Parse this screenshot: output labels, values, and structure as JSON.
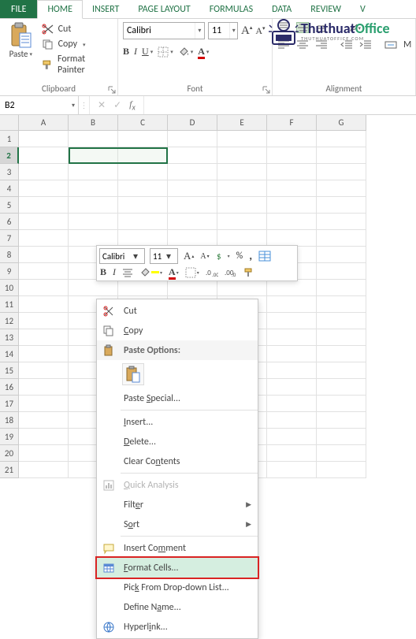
{
  "ribbon": {
    "tabs": {
      "file": "FILE",
      "home": "HOME",
      "insert": "INSERT",
      "pagelayout": "PAGE LAYOUT",
      "formulas": "FORMULAS",
      "data": "DATA",
      "review": "REVIEW",
      "v": "V"
    },
    "clipboard": {
      "paste": "Paste",
      "cut": "Cut",
      "copy": "Copy",
      "formatpainter": "Format Painter",
      "label": "Clipboard"
    },
    "font": {
      "name": "Calibri",
      "size": "11",
      "label": "Font"
    },
    "alignment": {
      "label": "Alignment",
      "merge_m": "M"
    }
  },
  "logo": {
    "thuthuat": "Thuthuat",
    "office": "Office",
    "sub": "THUTHUATOFFICE.COM"
  },
  "fxbar": {
    "namebox": "B2"
  },
  "grid": {
    "cols": [
      "A",
      "B",
      "C",
      "D",
      "E",
      "F",
      "G"
    ],
    "rows": [
      "1",
      "2",
      "3",
      "4",
      "5",
      "6",
      "7",
      "8",
      "9",
      "10",
      "11",
      "12",
      "13",
      "14",
      "15",
      "16",
      "17",
      "18",
      "19",
      "20",
      "21"
    ],
    "sel_row": "2"
  },
  "minibar": {
    "fname": "Calibri",
    "fsize": "11",
    "percent": "%",
    "comma": ","
  },
  "ctx": {
    "cut": "Cut",
    "copy": "Copy",
    "paste_options": "Paste Options:",
    "paste_special": "Paste Special...",
    "insert": "Insert...",
    "delete": "Delete...",
    "clear_contents": "Clear Contents",
    "quick_analysis": "Quick Analysis",
    "filter": "Filter",
    "sort": "Sort",
    "insert_comment": "Insert Comment",
    "format_cells": "Format Cells...",
    "pick_list": "Pick From Drop-down List...",
    "define_name": "Define Name...",
    "hyperlink": "Hyperlink..."
  }
}
